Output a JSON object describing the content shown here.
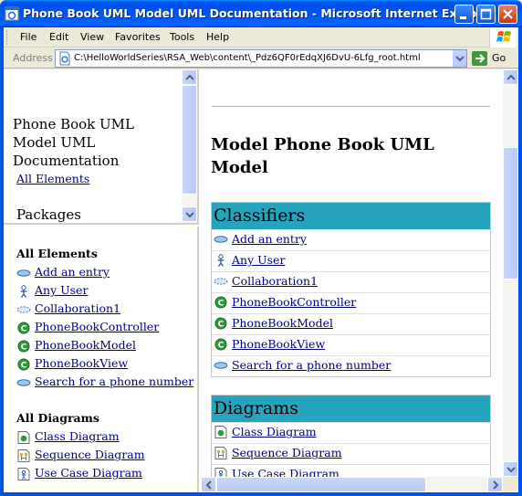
{
  "window": {
    "title": "Phone Book UML Model UML Documentation - Microsoft Internet Explorer"
  },
  "menu": {
    "items": [
      "File",
      "Edit",
      "View",
      "Favorites",
      "Tools",
      "Help"
    ]
  },
  "address": {
    "label": "Address",
    "url": "C:\\HelloWorldSeries\\RSA_Web\\content\\_Pdz6QF0rEdqXJ6DvU-6Lfg_root.html",
    "go_label": "Go"
  },
  "nav_frame": {
    "doc_title": "Phone Book UML Model UML Documentation",
    "all_elements_link": "All Elements",
    "packages_heading": "Packages"
  },
  "elements_frame": {
    "all_elements_heading": "All Elements",
    "elements": [
      {
        "label": "Add an entry",
        "icon": "use-case-icon"
      },
      {
        "label": "Any User",
        "icon": "actor-icon"
      },
      {
        "label": "Collaboration1",
        "icon": "collaboration-icon"
      },
      {
        "label": "PhoneBookController",
        "icon": "class-icon"
      },
      {
        "label": "PhoneBookModel",
        "icon": "class-icon"
      },
      {
        "label": "PhoneBookView",
        "icon": "class-icon"
      },
      {
        "label": "Search for a phone number",
        "icon": "use-case-icon"
      }
    ],
    "all_diagrams_heading": "All Diagrams",
    "diagrams": [
      {
        "label": "Class Diagram",
        "icon": "class-diagram-icon"
      },
      {
        "label": "Sequence Diagram",
        "icon": "sequence-diagram-icon"
      },
      {
        "label": "Use Case Diagram",
        "icon": "use-case-diagram-icon"
      }
    ]
  },
  "main_frame": {
    "title": "Model Phone Book UML Model",
    "classifiers_heading": "Classifiers",
    "classifiers": [
      {
        "label": "Add an entry",
        "icon": "use-case-icon"
      },
      {
        "label": "Any User",
        "icon": "actor-icon"
      },
      {
        "label": "Collaboration1",
        "icon": "collaboration-icon"
      },
      {
        "label": "PhoneBookController",
        "icon": "class-icon"
      },
      {
        "label": "PhoneBookModel",
        "icon": "class-icon"
      },
      {
        "label": "PhoneBookView",
        "icon": "class-icon"
      },
      {
        "label": "Search for a phone number",
        "icon": "use-case-icon"
      }
    ],
    "diagrams_heading": "Diagrams",
    "diagrams": [
      {
        "label": "Class Diagram",
        "icon": "class-diagram-icon"
      },
      {
        "label": "Sequence Diagram",
        "icon": "sequence-diagram-icon"
      },
      {
        "label": "Use Case Diagram",
        "icon": "use-case-diagram-icon"
      }
    ]
  },
  "colors": {
    "titlebar": "#0054e3",
    "section_header": "#26a4bd",
    "link": "#000080"
  }
}
